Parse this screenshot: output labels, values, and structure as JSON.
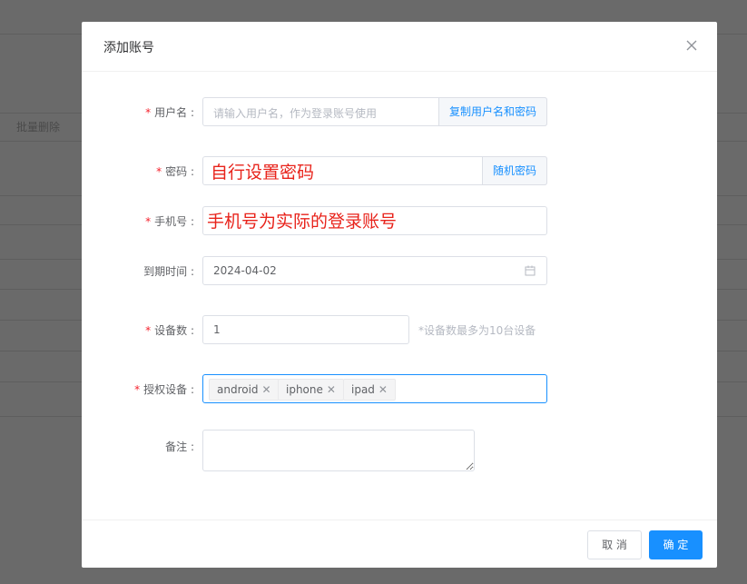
{
  "background": {
    "batch_delete_label": "批量删除"
  },
  "dialog": {
    "title": "添加账号"
  },
  "form": {
    "username": {
      "label": "用户名",
      "placeholder": "请输入用户名，作为登录账号使用",
      "append_label": "复制用户名和密码"
    },
    "password": {
      "label": "密码",
      "append_label": "随机密码",
      "annotation": "自行设置密码"
    },
    "phone": {
      "label": "手机号",
      "annotation": "手机号为实际的登录账号"
    },
    "expire": {
      "label": "到期时间",
      "value": "2024-04-02"
    },
    "devices": {
      "label": "设备数",
      "value": "1",
      "hint": "*设备数最多为10台设备"
    },
    "auth_devices": {
      "label": "授权设备",
      "tags": [
        "android",
        "iphone",
        "ipad"
      ]
    },
    "remark": {
      "label": "备注"
    }
  },
  "footer": {
    "cancel_label": "取 消",
    "ok_label": "确 定"
  },
  "colors": {
    "accent": "#1890ff",
    "required": "#f5222d",
    "annotation": "#e8231b"
  }
}
